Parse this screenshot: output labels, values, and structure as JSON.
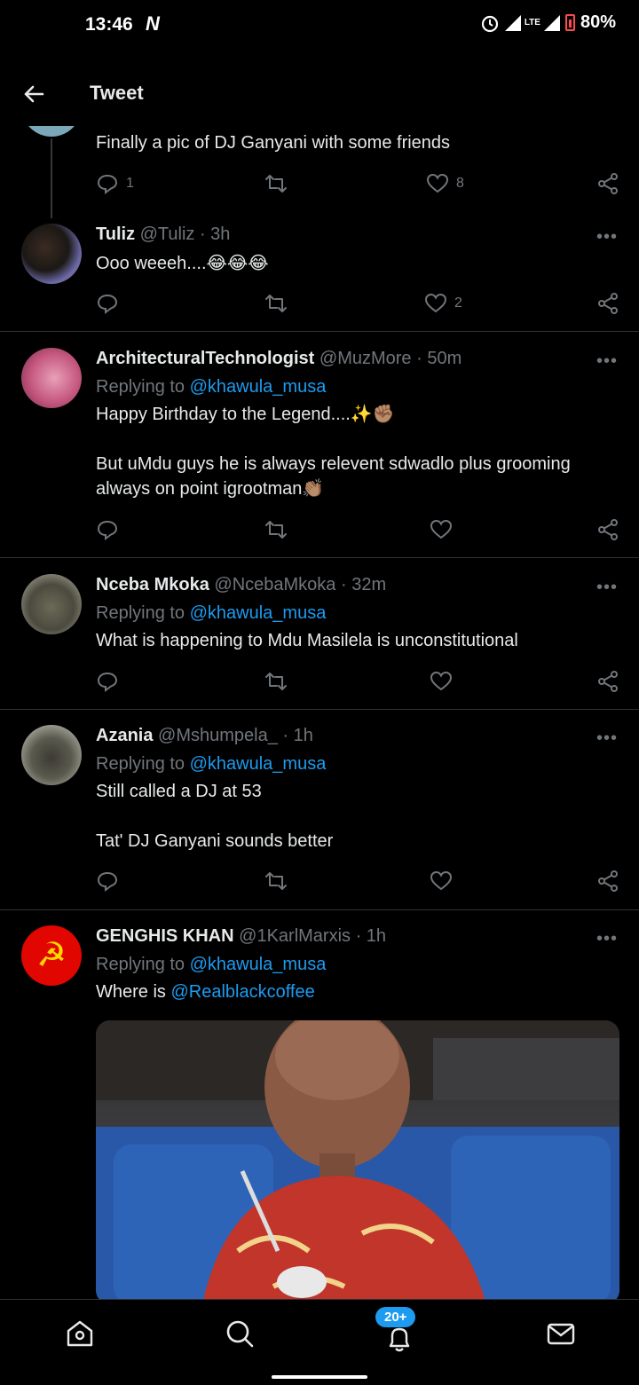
{
  "status": {
    "time": "13:46",
    "carrier_logo": "N",
    "lte": "LTE",
    "battery": "80%"
  },
  "header": {
    "title": "Tweet"
  },
  "tweets": [
    {
      "body": "Finally a pic of DJ Ganyani with some friends",
      "replies": "1",
      "likes": "8"
    },
    {
      "name": "Tuliz",
      "handle": "@Tuliz · 3h",
      "body": "Ooo weeeh....😂😂😂",
      "likes": "2"
    },
    {
      "name": "ArchitecturalTechnologist",
      "handle": "@MuzMore · 50m",
      "replying_to": "Replying to",
      "reply_user": "@khawula_musa",
      "body_p1": "Happy Birthday to the Legend....✨✊🏽",
      "body_p2": "But uMdu guys he is always relevent sdwadlo plus grooming always on point igrootman👏🏽"
    },
    {
      "name": "Nceba Mkoka",
      "handle": "@NcebaMkoka · 32m",
      "replying_to": "Replying to",
      "reply_user": "@khawula_musa",
      "body": "What is happening to Mdu Masilela is unconstitutional"
    },
    {
      "name": "Azania",
      "handle": "@Mshumpela_ · 1h",
      "replying_to": "Replying to",
      "reply_user": "@khawula_musa",
      "body_p1": "Still called a DJ at 53",
      "body_p2": "Tat' DJ Ganyani sounds better"
    },
    {
      "name": "GENGHIS KHAN",
      "handle": "@1KarlMarxis · 1h",
      "replying_to": "Replying to",
      "reply_user": "@khawula_musa",
      "body_prefix": "Where is ",
      "body_link": "@Realblackcoffee",
      "avatar_symbol": "☭"
    }
  ],
  "more_label": "•••",
  "nav": {
    "notifications_badge": "20+"
  },
  "colors": {
    "accent": "#1d9bf0",
    "muted": "#71767b",
    "background": "#000000"
  }
}
